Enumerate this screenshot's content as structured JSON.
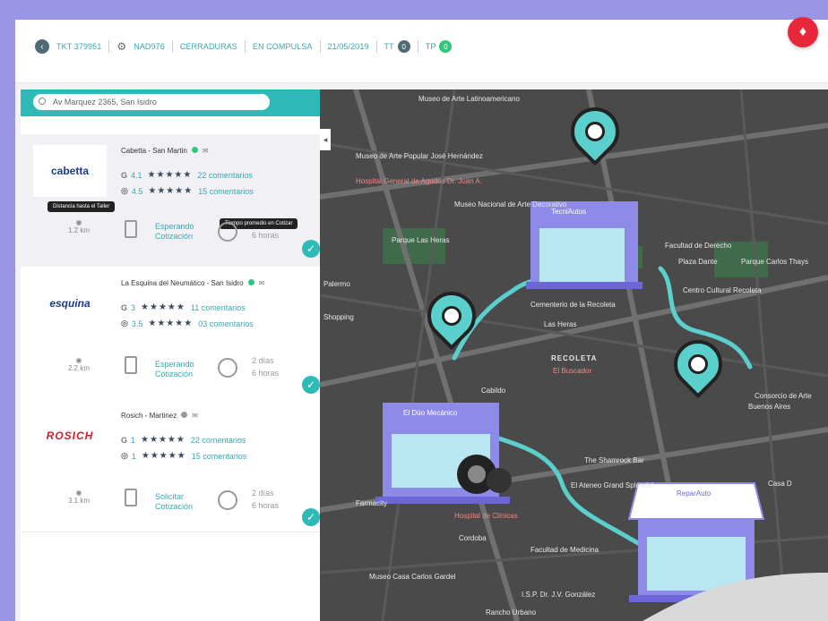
{
  "header": {
    "ticket": "TKT 379951",
    "vehicle_code": "NAD976",
    "category": "CERRADURAS",
    "status": "EN COMPULSA",
    "date": "21/05/2019",
    "tt_label": "TT",
    "tt_count": "0",
    "tp_label": "TP",
    "tp_count": "0"
  },
  "search": {
    "value": "Av Marquez 2365, San Isidro"
  },
  "workshops": [
    {
      "name": "Cabetta - San Martin",
      "logo_text": "cabetta",
      "google_rating": "4.1",
      "google_comments": "22 comentarios",
      "local_rating": "4.5",
      "local_comments": "15 comentarios",
      "distance": "1.2 km",
      "status_line1": "Esperando",
      "status_line2": "Cotización",
      "time_days": "",
      "time_hours": "6 horas",
      "tooltip_distance": "Distancia hasta el Taller",
      "tooltip_time": "Tiempo promedio en Cotizar"
    },
    {
      "name": "La Esquina del Neumático - San Isidro",
      "logo_text": "esquina",
      "google_rating": "3",
      "google_comments": "11 comentarios",
      "local_rating": "3.5",
      "local_comments": "03 comentarios",
      "distance": "2.2 km",
      "status_line1": "Esperando",
      "status_line2": "Cotización",
      "time_days": "2 días",
      "time_hours": "6 horas"
    },
    {
      "name": "Rosich - Martinez",
      "logo_text": "ROSICH",
      "google_rating": "1",
      "google_comments": "22 comentarios",
      "local_rating": "1",
      "local_comments": "15 comentarios",
      "distance": "3.1 km",
      "status_line1": "Solicitar",
      "status_line2": "Cotización",
      "time_days": "2 días",
      "time_hours": "6 horas"
    }
  ],
  "map": {
    "shops": [
      "TecniAutos",
      "El Dúo Mecánico",
      "ReparAuto"
    ],
    "labels": [
      "Museo de Arte Latinoamericano",
      "Museo de Arte Popular José Hernández",
      "Hospital General de Agudos Dr. Juan A.",
      "Museo Nacional de Arte Decorativo",
      "Parque Las Heras",
      "Facultad de Derecho",
      "Plaza Dante",
      "Parque Carlos Thays",
      "Centro Cultural Recoleta",
      "Cementerio de la Recoleta",
      "RECOLETA",
      "El Buscador",
      "Las Heras",
      "Palermo",
      "Shopping",
      "Cabildo",
      "Facultad de Medicina",
      "Museo Casa Carlos Gardel",
      "Rancho Urbano",
      "Cordoba",
      "Buenos Aires",
      "Consorcio de Arte",
      "The Shamrock Bar",
      "El Ateneo Grand Splendid",
      "Hospital de Clínicas",
      "I.S.P. Dr. J.V. González",
      "Farmacity",
      "Casa D"
    ],
    "colors": {
      "route": "#5acfcb",
      "pin": "#5acfcb",
      "shop": "#8e8ae8"
    }
  },
  "icons": {
    "alert": "alert-icon",
    "check": "check-icon",
    "distance": "location-icon",
    "document": "document-icon",
    "timer": "timer-icon"
  }
}
